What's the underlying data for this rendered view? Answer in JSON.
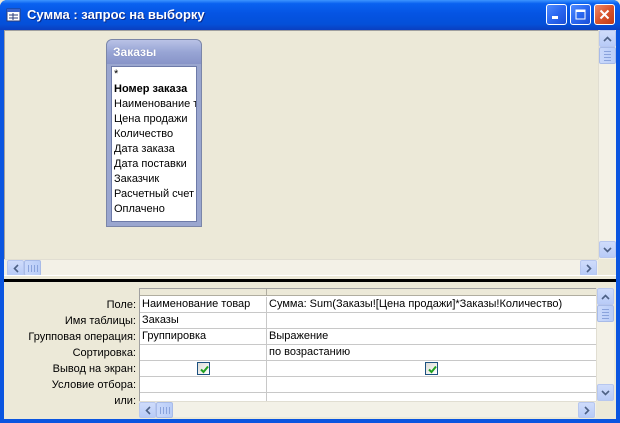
{
  "window": {
    "title": "Сумма : запрос на выборку"
  },
  "table": {
    "name": "Заказы",
    "fields": [
      {
        "label": "*",
        "key": false
      },
      {
        "label": "Номер заказа",
        "key": true
      },
      {
        "label": "Наименование т",
        "key": false
      },
      {
        "label": "Цена продажи",
        "key": false
      },
      {
        "label": "Количество",
        "key": false
      },
      {
        "label": "Дата заказа",
        "key": false
      },
      {
        "label": "Дата поставки",
        "key": false
      },
      {
        "label": "Заказчик",
        "key": false
      },
      {
        "label": "Расчетный счет",
        "key": false
      },
      {
        "label": "Оплачено",
        "key": false
      }
    ]
  },
  "grid": {
    "row_labels": [
      "Поле:",
      "Имя таблицы:",
      "Групповая операция:",
      "Сортировка:",
      "Вывод на экран:",
      "Условие отбора:",
      "или:"
    ],
    "columns": [
      {
        "field": "Наименование товар",
        "table": "Заказы",
        "group": "Группировка",
        "sort": "",
        "show": true,
        "criteria": "",
        "or": ""
      },
      {
        "field": "Сумма: Sum(Заказы![Цена продажи]*Заказы!Количество)",
        "table": "",
        "group": "Выражение",
        "sort": "по возрастанию",
        "show": true,
        "criteria": "",
        "or": ""
      }
    ]
  },
  "colors": {
    "titlebar": "#0554e3",
    "frame": "#0a55e0",
    "table_header": "#98a5d5",
    "check": "#21a121"
  }
}
